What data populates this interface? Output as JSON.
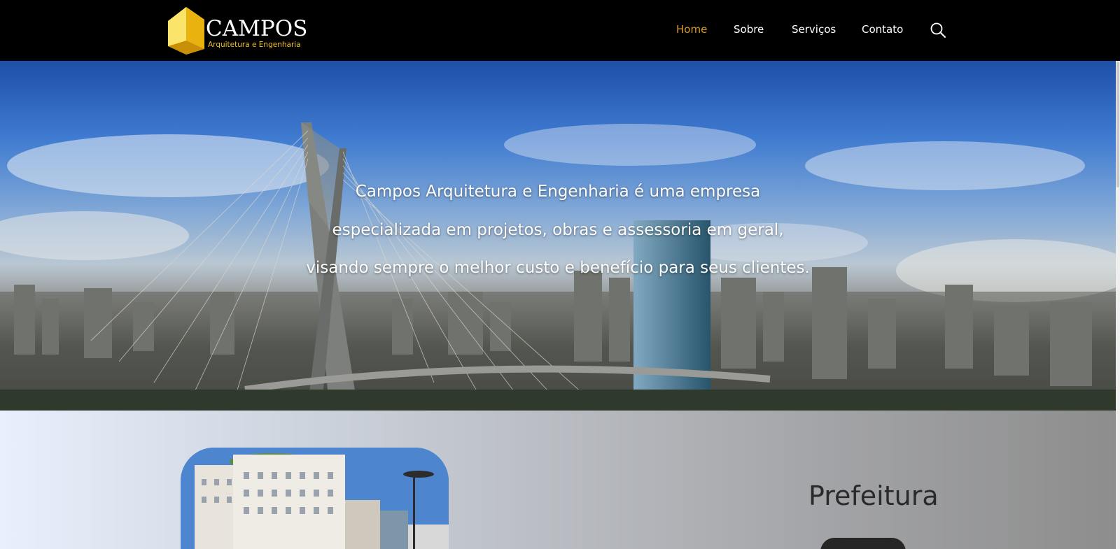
{
  "brand": {
    "name": "CAMPOS",
    "tagline": "Arquitetura e Engenharia",
    "accent_color": "#f3c316"
  },
  "nav": {
    "items": [
      {
        "label": "Home",
        "active": true
      },
      {
        "label": "Sobre",
        "active": false
      },
      {
        "label": "Serviços",
        "active": false
      },
      {
        "label": "Contato",
        "active": false
      }
    ],
    "search_icon": "search-icon",
    "active_color": "#d99a2b"
  },
  "hero": {
    "lines": [
      "Campos Arquitetura e Engenharia é uma empresa",
      "especializada em projetos, obras e assessoria em geral,",
      "visando sempre o melhor custo e benefício para seus clientes."
    ]
  },
  "feature": {
    "title": "Prefeitura"
  }
}
